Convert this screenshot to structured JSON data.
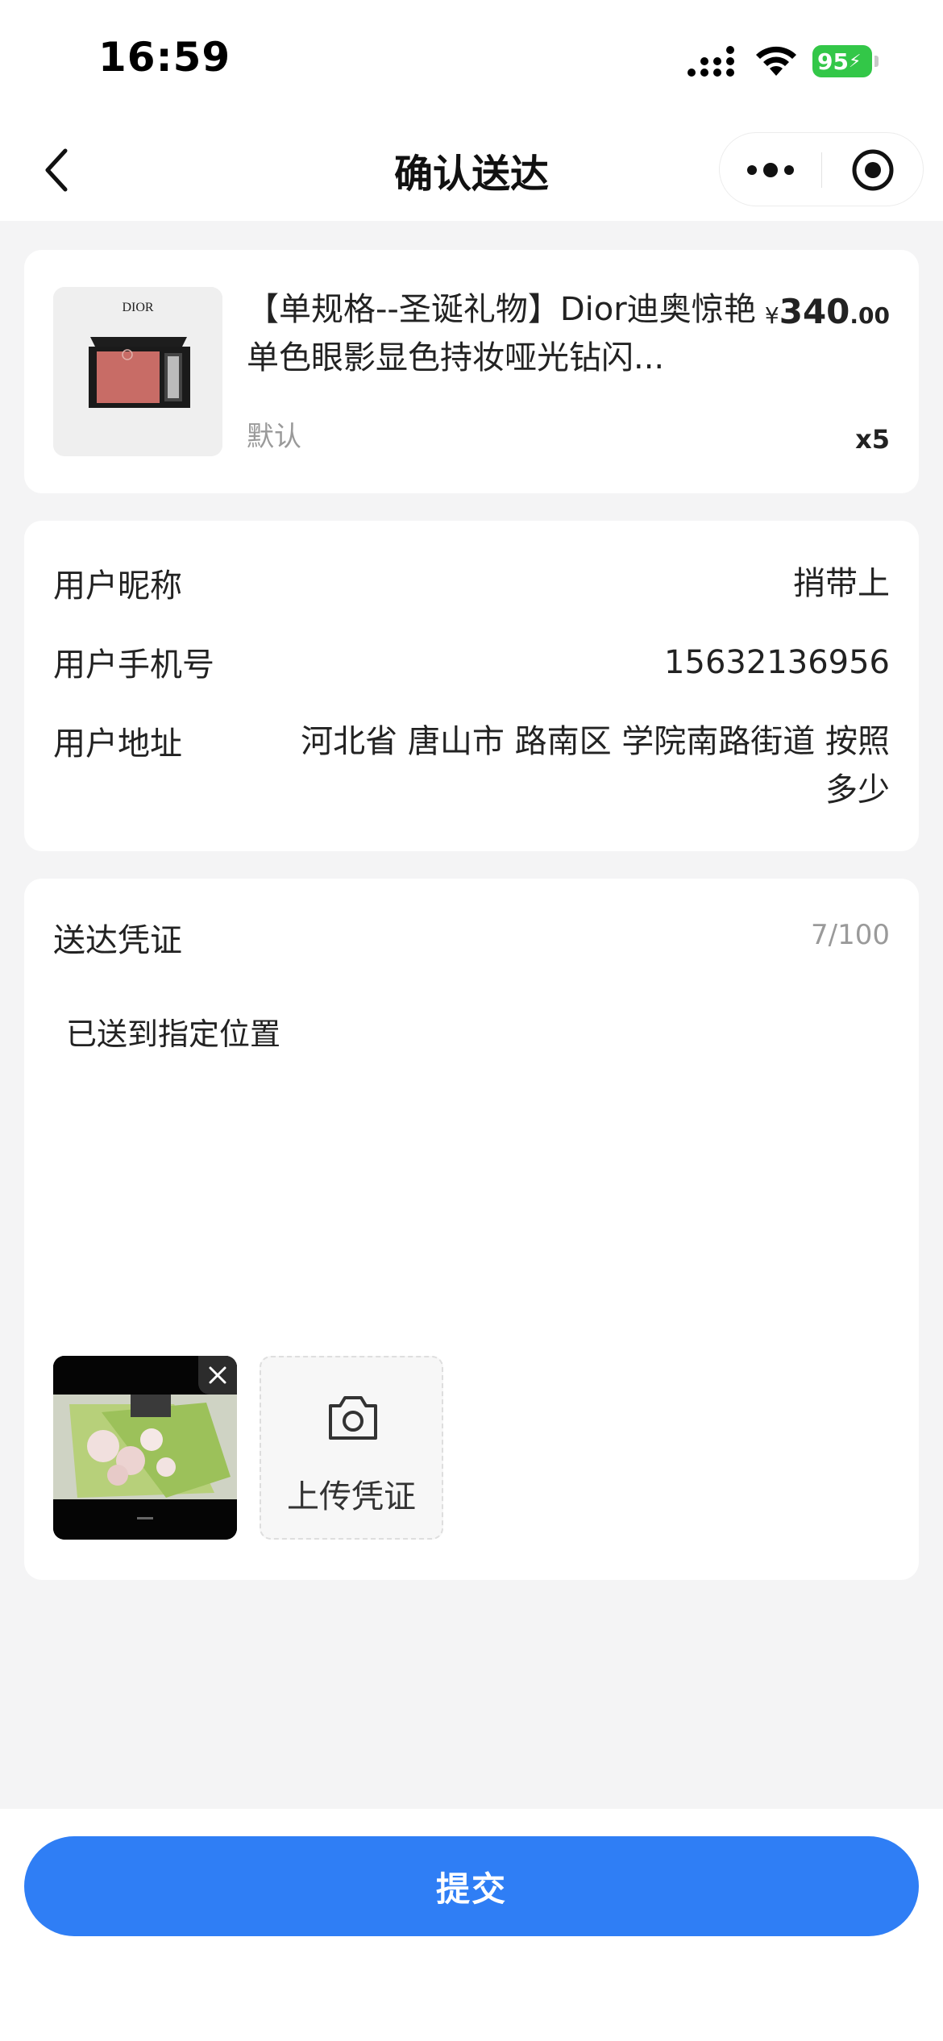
{
  "status_bar": {
    "time": "16:59",
    "battery": "95"
  },
  "nav": {
    "title": "确认送达",
    "back_icon": "chevron-left-icon",
    "more_icon": "more-dots-icon",
    "close_icon": "target-circle-icon"
  },
  "product": {
    "brand": "DIOR",
    "title": "【单规格--圣诞礼物】Dior迪奥惊艳单色眼影显色持妆哑光钻闪...",
    "spec": "默认",
    "price_symbol": "¥",
    "price_int": "340",
    "price_dec": ".00",
    "quantity": "x5"
  },
  "user_info": {
    "nickname_label": "用户昵称",
    "nickname_value": "捎带上",
    "phone_label": "用户手机号",
    "phone_value": "15632136956",
    "address_label": "用户地址",
    "address_value": "河北省 唐山市 路南区 学院南路街道 按照多少"
  },
  "proof": {
    "label": "送达凭证",
    "count": "7/100",
    "text": "已送到指定位置",
    "upload_label": "上传凭证",
    "upload_icon": "camera-icon",
    "remove_icon": "close-icon"
  },
  "footer": {
    "submit_label": "提交"
  },
  "colors": {
    "accent": "#2f7ef5",
    "battery": "#33c748",
    "background": "#f4f4f5"
  }
}
